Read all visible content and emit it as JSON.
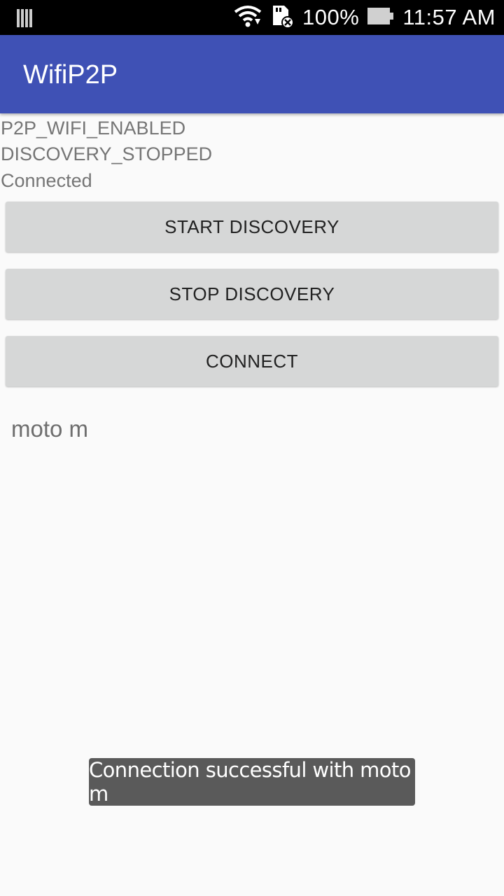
{
  "status_bar": {
    "battery_percent": "100%",
    "time": "11:57 AM",
    "icons": [
      "signal-bars-icon",
      "wifi-icon",
      "sd-card-icon",
      "battery-icon"
    ]
  },
  "app_bar": {
    "title": "WifiP2P"
  },
  "status_lines": [
    "P2P_WIFI_ENABLED",
    "DISCOVERY_STOPPED",
    "Connected"
  ],
  "buttons": {
    "start_discovery": "START DISCOVERY",
    "stop_discovery": "STOP DISCOVERY",
    "connect": "CONNECT"
  },
  "devices": [
    "moto m"
  ],
  "toast": "Connection successful with moto m",
  "colors": {
    "primary": "#3f51b5",
    "button_bg": "#d6d7d7",
    "toast_bg": "#5a5a5a"
  }
}
